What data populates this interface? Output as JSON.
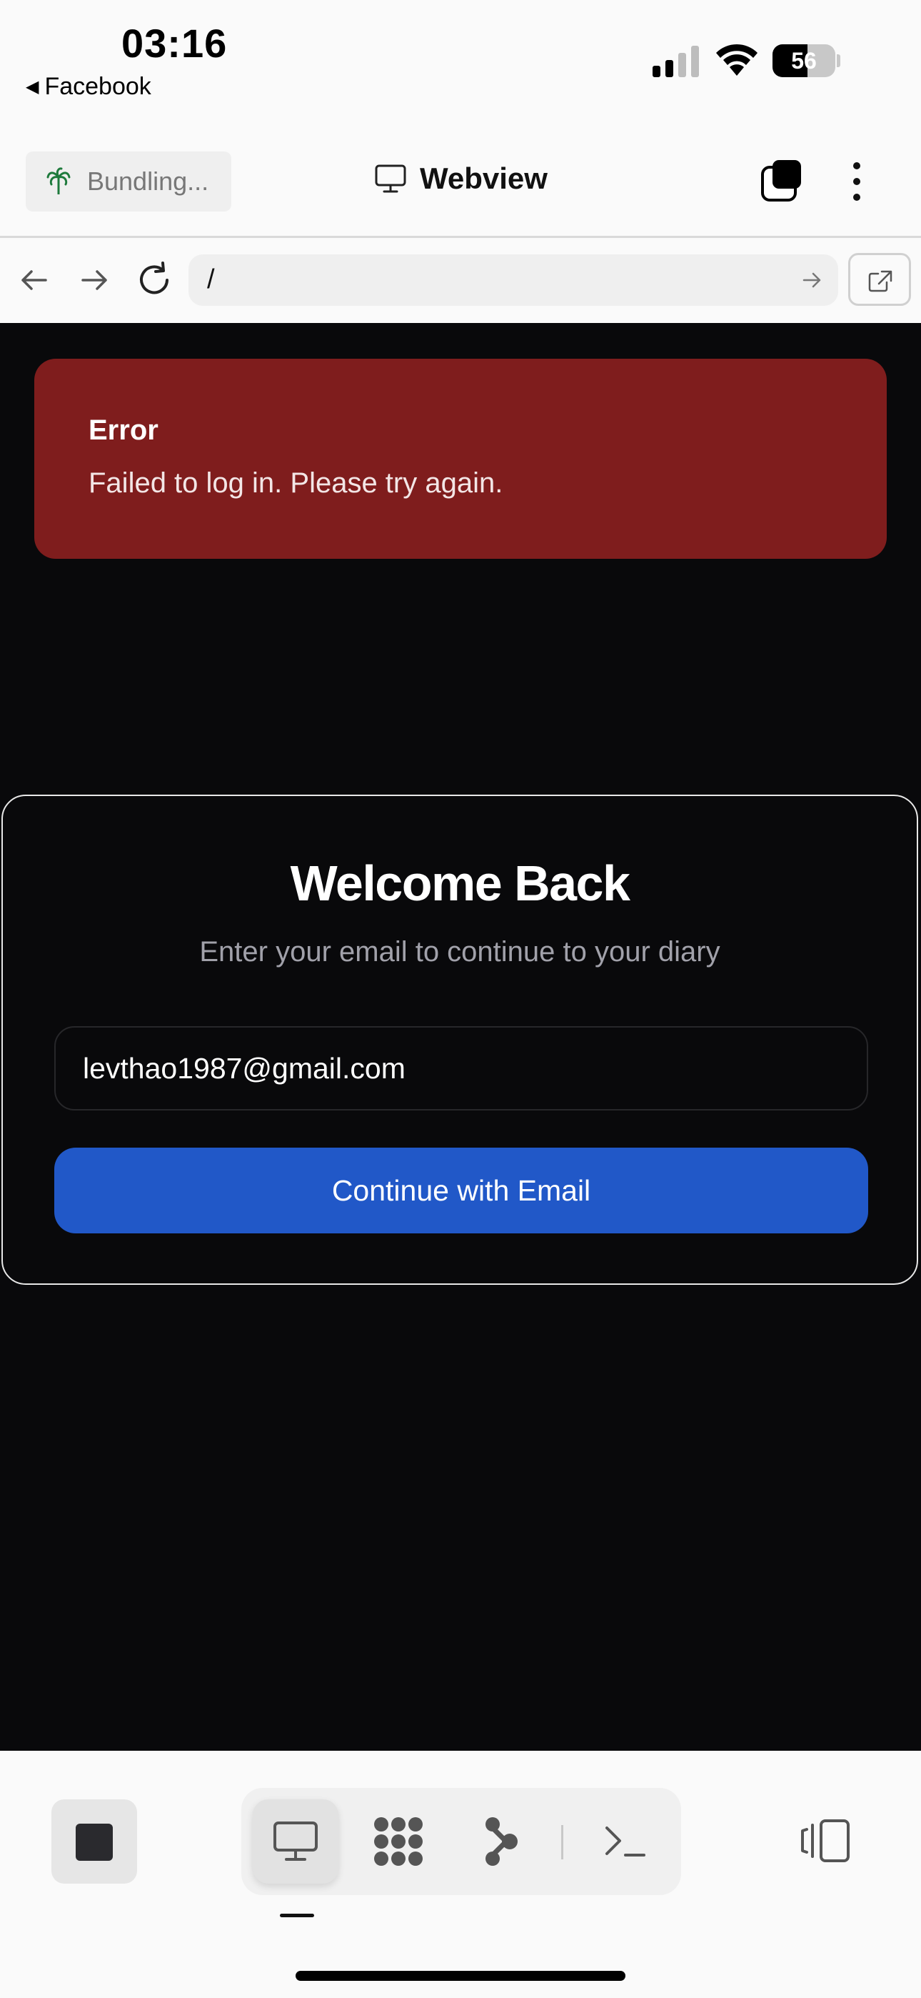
{
  "status_bar": {
    "time": "03:16",
    "back_app": "Facebook",
    "battery_percent": 56
  },
  "header": {
    "bundling_label": "Bundling...",
    "title": "Webview"
  },
  "urlbar": {
    "path": "/"
  },
  "error": {
    "title": "Error",
    "message": "Failed to log in. Please try again."
  },
  "login": {
    "heading": "Welcome Back",
    "subtitle": "Enter your email to continue to your diary",
    "email_value": "levthao1987@gmail.com",
    "button_label": "Continue with Email"
  },
  "toolbar": {
    "active_tab": "webview",
    "items": [
      "webview",
      "grid",
      "share",
      "terminal"
    ]
  },
  "colors": {
    "error_bg": "#7f1d1d",
    "content_bg": "#09090b",
    "primary_button": "#2158c8"
  }
}
